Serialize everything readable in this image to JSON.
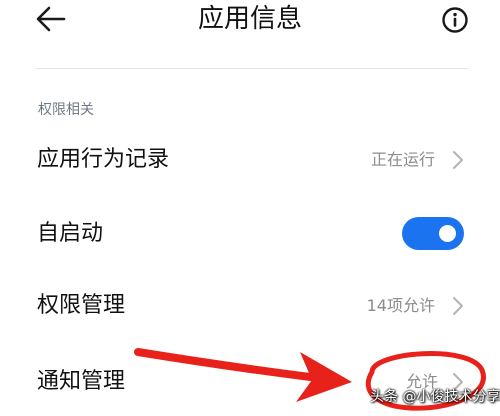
{
  "header": {
    "title": "应用信息",
    "back_icon": "arrow-left-icon",
    "info_icon": "info-circle-icon"
  },
  "section": {
    "label": "权限相关"
  },
  "rows": [
    {
      "label": "应用行为记录",
      "value": "正在运行",
      "chevron": true
    },
    {
      "label": "自启动",
      "toggle_on": true
    },
    {
      "label": "权限管理",
      "value": "14项允许",
      "chevron": true
    },
    {
      "label": "通知管理",
      "value": "允许",
      "chevron": true
    }
  ],
  "annotation": {
    "arrow_color": "#e8211a",
    "circle_color": "#e8211a"
  },
  "watermark": {
    "text": "头条 @小俊技术分享"
  },
  "colors": {
    "toggle_active": "#1b73f0",
    "secondary_text": "#8c8c8c",
    "section_label": "#6f7a86"
  }
}
